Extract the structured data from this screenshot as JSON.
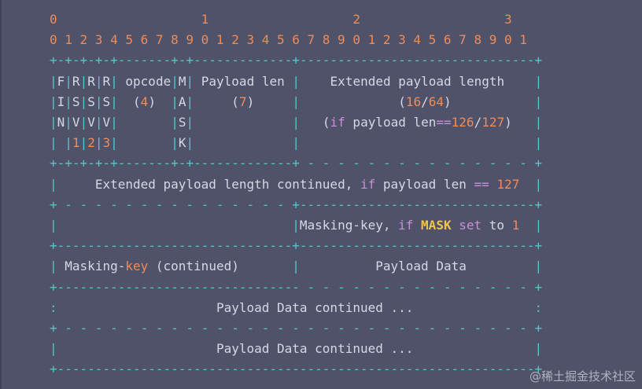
{
  "header": {
    "tens": "0                   1                   2                   3",
    "bits": "0 1 2 3 4 5 6 7 8 9 0 1 2 3 4 5 6 7 8 9 0 1 2 3 4 5 6 7 8 9 0 1"
  },
  "fields": {
    "fin": [
      "F",
      "I",
      "N"
    ],
    "rsv1": [
      "R",
      "S",
      "V",
      "1"
    ],
    "rsv2": [
      "R",
      "S",
      "V",
      "2"
    ],
    "rsv3": [
      "R",
      "S",
      "V",
      "3"
    ],
    "opcode_label": "opcode",
    "opcode_bits": "4",
    "mask": [
      "M",
      "A",
      "S",
      "K"
    ],
    "payload_len_label": "Payload len",
    "payload_len_bits": "7",
    "ext_len_label": "Extended payload length",
    "ext_len_bits_a": "16",
    "ext_len_bits_b": "64",
    "ext_len_cond_if": "if",
    "ext_len_cond_text": " payload len",
    "ext_len_cond_eq": "==",
    "ext_len_cond_a": "126",
    "ext_len_cond_b": "127",
    "ext_cont_text": "Extended payload length continued, ",
    "ext_cont_if": "if",
    "ext_cont_mid": " payload len ",
    "ext_cont_eq": "==",
    "ext_cont_val": "127",
    "mkey_label": "Masking-key, ",
    "mkey_if": "if",
    "mkey_mask": "MASK",
    "mkey_set": "set",
    "mkey_to": " to ",
    "mkey_one": "1",
    "mkey_cont_a": "Masking-",
    "mkey_cont_b": "key",
    "mkey_cont_c": " (continued)",
    "payload_data": "Payload Data",
    "payload_cont": "Payload Data continued ..."
  },
  "watermark": "@稀土掘金技术社区"
}
